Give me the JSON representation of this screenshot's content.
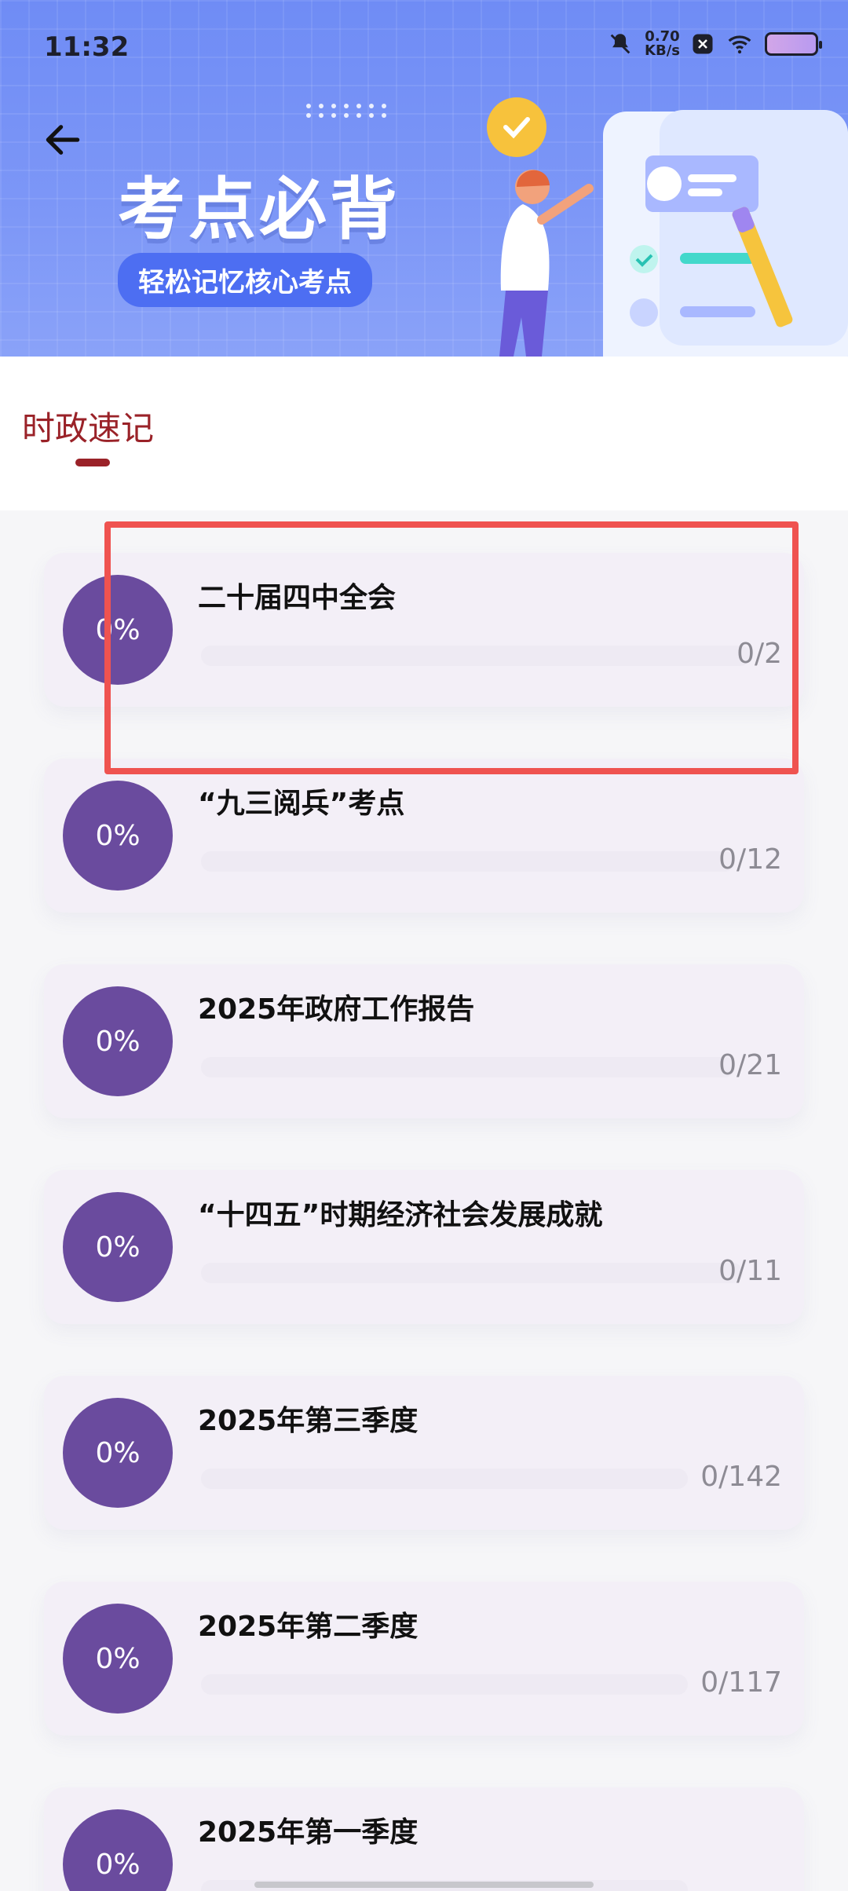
{
  "status": {
    "time": "11:32",
    "speed_value": "0.70",
    "speed_unit": "KB/s"
  },
  "header": {
    "title": "考点必背",
    "subtitle": "轻松记忆核心考点"
  },
  "tabs": [
    {
      "label": "时政速记",
      "active": true
    }
  ],
  "list": {
    "items": [
      {
        "title": "二十届四中全会",
        "percent": "0%",
        "count": "0/2",
        "progress": 0
      },
      {
        "title": "“九三阅兵”考点",
        "percent": "0%",
        "count": "0/12",
        "progress": 0
      },
      {
        "title": "2025年政府工作报告",
        "percent": "0%",
        "count": "0/21",
        "progress": 0
      },
      {
        "title": "“十四五”时期经济社会发展成就",
        "percent": "0%",
        "count": "0/11",
        "progress": 0
      },
      {
        "title": "2025年第三季度",
        "percent": "0%",
        "count": "0/142",
        "progress": 0
      },
      {
        "title": "2025年第二季度",
        "percent": "0%",
        "count": "0/117",
        "progress": 0
      },
      {
        "title": "2025年第一季度",
        "percent": "0%",
        "count": "",
        "progress": 0
      }
    ]
  },
  "colors": {
    "accent_red": "#9a2228",
    "circle_purple": "#6a4b9e",
    "banner_blue": "#6f8cf5",
    "highlight_red": "#ef5350"
  }
}
